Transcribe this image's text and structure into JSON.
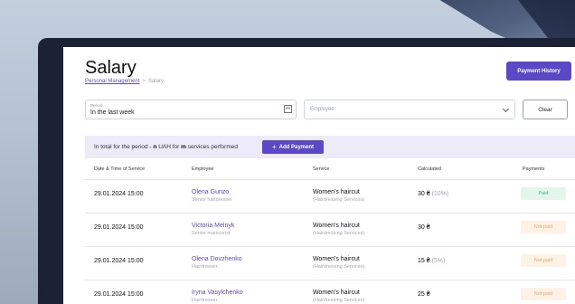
{
  "page": {
    "title": "Salary",
    "breadcrumb": {
      "parent": "Personal Management",
      "separator": ">",
      "current": "Salary"
    },
    "payment_history_button": "Payment History"
  },
  "filters": {
    "period_label": "Period",
    "period_value": "In the last week",
    "employee_placeholder": "Employee",
    "clear_button": "Clear"
  },
  "summary": {
    "prefix": "In total for the period - ",
    "total": "n",
    "currency": " UAH for ",
    "count": "m",
    "suffix": " services performed",
    "add_payment_button": "Add Payment",
    "add_icon": "plus-icon"
  },
  "table": {
    "headers": [
      "Date & Time of Service",
      "Employee",
      "Service",
      "Calculated",
      "Payments"
    ],
    "rows": [
      {
        "date": "29.01.2024 15:00",
        "employee": "Olena Gunzo",
        "role": "Senior hairdresser",
        "service": "Women's haircut",
        "category": "(Hairdressing Services)",
        "calculated": "30 ₴",
        "percent": "(10%)",
        "payment": "Paid",
        "paid": true
      },
      {
        "date": "29.01.2024 15:00",
        "employee": "Victoria Melnyk",
        "role": "Senior manicurist",
        "service": "Women's haircut",
        "category": "(Hairdressing Services)",
        "calculated": "30 ₴",
        "percent": "",
        "payment": "Not paid",
        "paid": false
      },
      {
        "date": "29.01.2024 15:00",
        "employee": "Olena Dovzhenko",
        "role": "Hairdresser",
        "service": "Women's haircut",
        "category": "(Hairdressing Services)",
        "calculated": "15 ₴",
        "percent": "(5%)",
        "payment": "Not paid",
        "paid": false
      },
      {
        "date": "29.01.2024 15:00",
        "employee": "Iryna Vasylchenko",
        "role": "Hairdresser",
        "service": "Women's haircut",
        "category": "(Hairdressing Services)",
        "calculated": "25 ₴",
        "percent": "",
        "payment": "Not paid",
        "paid": false
      }
    ]
  },
  "colors": {
    "accent": "#5b48c7",
    "paid": "#44b678",
    "not_paid": "#f0a56b",
    "summary_bg": "#ecebf7"
  }
}
